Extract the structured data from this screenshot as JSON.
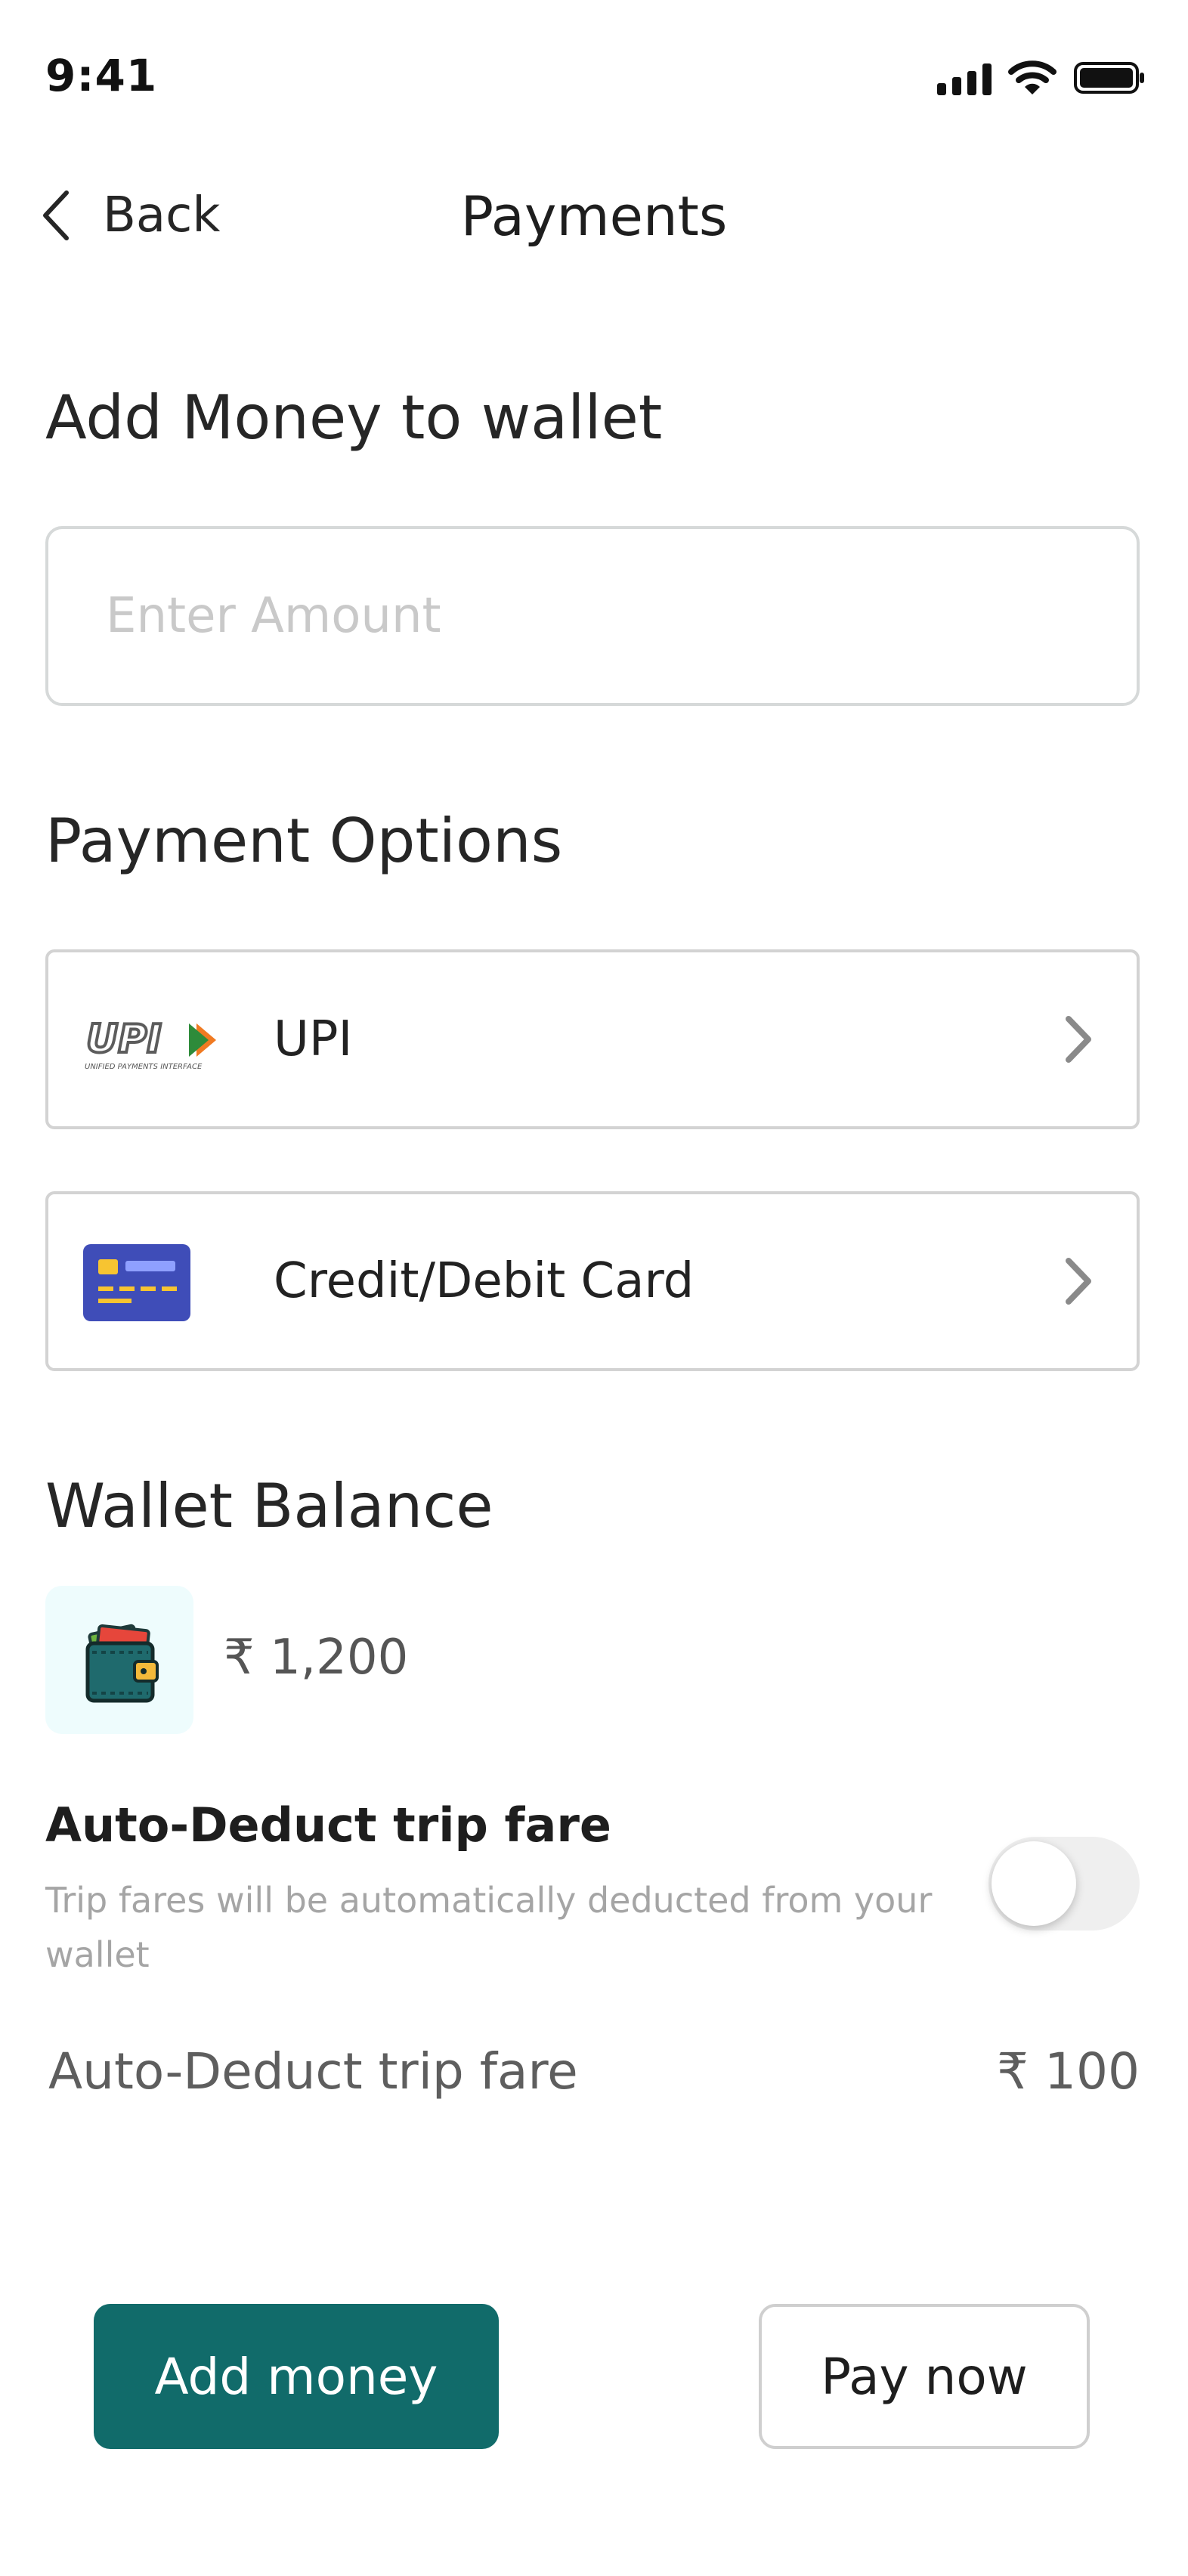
{
  "status_bar": {
    "time": "9:41"
  },
  "nav": {
    "back_label": "Back",
    "title": "Payments"
  },
  "add_money": {
    "heading": "Add Money to wallet",
    "amount_placeholder": "Enter Amount",
    "amount_value": ""
  },
  "payment_options": {
    "heading": "Payment Options",
    "items": [
      {
        "label": "UPI",
        "icon": "upi-logo",
        "logo_text": "UPI",
        "logo_caption": "UNIFIED PAYMENTS INTERFACE"
      },
      {
        "label": "Credit/Debit Card",
        "icon": "credit-card-icon"
      }
    ]
  },
  "wallet": {
    "heading": "Wallet Balance",
    "balance": "₹ 1,200",
    "icon": "wallet-icon"
  },
  "auto_deduct": {
    "title": "Auto-Deduct trip fare",
    "description": "Trip fares will be automatically deducted from your wallet",
    "toggle_on": false,
    "fare_label": "Auto-Deduct trip fare",
    "fare_value": "₹ 100"
  },
  "actions": {
    "add_money_label": "Add money",
    "pay_now_label": "Pay now"
  },
  "colors": {
    "primary": "#116b6a",
    "card_blue": "#3f4db8",
    "wallet_tile": "#eefcfd"
  }
}
